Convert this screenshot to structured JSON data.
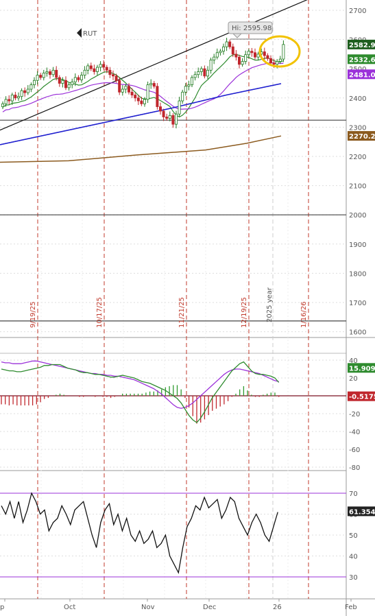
{
  "symbol": "RUT",
  "hi_label": "Hi: 2595.98",
  "watermark": "2025 year",
  "colors": {
    "up": "#1e7a1e",
    "down": "#c0272d",
    "ma_green": "#2e8b2e",
    "ma_purple": "#9b30d9",
    "ma_blue": "#1f1fcf",
    "ma_brown": "#8b5a1e",
    "vline": "#c0392b",
    "circle": "#f2c200",
    "grid": "#dddddd"
  },
  "vertical_date_labels": [
    "9/19/25",
    "10/17/25",
    "11/21/25",
    "12/19/25",
    "1/16/26"
  ],
  "x_axis_labels": [
    "p",
    "Oct",
    "Nov",
    "Dec",
    "26",
    "Feb"
  ],
  "price_tags": [
    {
      "text": "2582.9",
      "color": "#1e5e1e"
    },
    {
      "text": "2532.61",
      "color": "#2e8b2e"
    },
    {
      "text": "2481.04",
      "color": "#9b30d9"
    },
    {
      "text": "2270.22",
      "color": "#8b5a1e"
    }
  ],
  "macd_tags": [
    {
      "text": "15.9098",
      "color": "#2e8b2e"
    },
    {
      "text": "-0.5175",
      "color": "#c0272d"
    }
  ],
  "rsi_tag": {
    "text": "61.3544",
    "color": "#222222"
  },
  "chart_data": [
    {
      "type": "line",
      "title": "RUT",
      "ylim": [
        1570,
        2730
      ],
      "y_ticks": [
        2700,
        2600,
        2500,
        2400,
        2300,
        2200,
        2100,
        2000,
        1900,
        1800,
        1700,
        1600
      ],
      "horizontal_lines": [
        2324,
        2000,
        1637
      ],
      "close": [
        2380,
        2395,
        2390,
        2410,
        2400,
        2405,
        2425,
        2418,
        2430,
        2445,
        2460,
        2478,
        2470,
        2485,
        2490,
        2480,
        2495,
        2470,
        2450,
        2460,
        2435,
        2445,
        2455,
        2470,
        2462,
        2478,
        2495,
        2510,
        2500,
        2490,
        2505,
        2515,
        2505,
        2495,
        2480,
        2475,
        2460,
        2420,
        2430,
        2440,
        2420,
        2410,
        2400,
        2390,
        2380,
        2395,
        2445,
        2450,
        2440,
        2370,
        2355,
        2335,
        2330,
        2340,
        2310,
        2345,
        2390,
        2420,
        2440,
        2445,
        2470,
        2480,
        2490,
        2500,
        2475,
        2495,
        2530,
        2540,
        2555,
        2560,
        2575,
        2592,
        2575,
        2550,
        2540,
        2515,
        2525,
        2548,
        2560,
        2555,
        2540,
        2550,
        2558,
        2545,
        2535,
        2520,
        2515,
        2525,
        2533,
        2583
      ],
      "moving_averages": [
        {
          "name": "MA green",
          "value": 2532.61
        },
        {
          "name": "MA purple",
          "value": 2481.04
        },
        {
          "name": "MA blue",
          "value": 2449
        },
        {
          "name": "MA brown",
          "value": 2270.22
        }
      ],
      "hi": 2595.98
    },
    {
      "type": "line",
      "title": "MACD",
      "ylim": [
        -80,
        45
      ],
      "y_ticks": [
        40,
        20,
        0,
        -20,
        -40,
        -60,
        -80
      ],
      "macd": [
        30,
        29,
        28,
        28,
        27,
        27,
        28,
        29,
        30,
        31,
        32,
        34,
        34,
        35,
        35,
        35,
        33,
        31,
        30,
        29,
        27,
        26,
        26,
        25,
        24,
        24,
        23,
        22,
        21,
        21,
        22,
        23,
        22,
        21,
        20,
        18,
        16,
        15,
        14,
        12,
        10,
        8,
        6,
        3,
        0,
        -3,
        -8,
        -15,
        -22,
        -27,
        -30,
        -25,
        -18,
        -10,
        -2,
        4,
        10,
        16,
        22,
        28,
        32,
        36,
        38,
        33,
        28,
        25,
        24,
        24,
        23,
        22,
        20,
        15
      ],
      "signal": [
        38,
        37,
        37,
        36,
        36,
        36,
        37,
        38,
        39,
        39,
        38,
        37,
        36,
        35,
        34,
        33,
        32,
        31,
        30,
        29,
        28,
        27,
        26,
        25,
        25,
        24,
        24,
        23,
        23,
        22,
        22,
        21,
        20,
        19,
        18,
        16,
        14,
        12,
        10,
        8,
        5,
        2,
        -2,
        -6,
        -10,
        -13,
        -14,
        -13,
        -11,
        -8,
        -4,
        0,
        4,
        8,
        12,
        16,
        20,
        24,
        27,
        29,
        30,
        30,
        29,
        28,
        27,
        26,
        25,
        23,
        21,
        19,
        17,
        16
      ],
      "histogram_last": -0.5175,
      "macd_last": 15.9098
    },
    {
      "type": "line",
      "title": "RSI",
      "ylim": [
        23,
        76
      ],
      "y_ticks": [
        70,
        60,
        50,
        40,
        30
      ],
      "bands": [
        70,
        30
      ],
      "values": [
        64,
        60,
        66,
        58,
        66,
        56,
        62,
        70,
        66,
        60,
        62,
        52,
        56,
        58,
        64,
        60,
        55,
        62,
        64,
        66,
        58,
        50,
        44,
        56,
        62,
        65,
        55,
        60,
        52,
        58,
        50,
        47,
        52,
        46,
        48,
        52,
        44,
        46,
        50,
        40,
        36,
        32,
        44,
        54,
        58,
        64,
        62,
        68,
        63,
        65,
        67,
        58,
        62,
        68,
        66,
        58,
        54,
        50,
        56,
        60,
        56,
        50,
        47,
        54,
        61
      ]
    }
  ]
}
